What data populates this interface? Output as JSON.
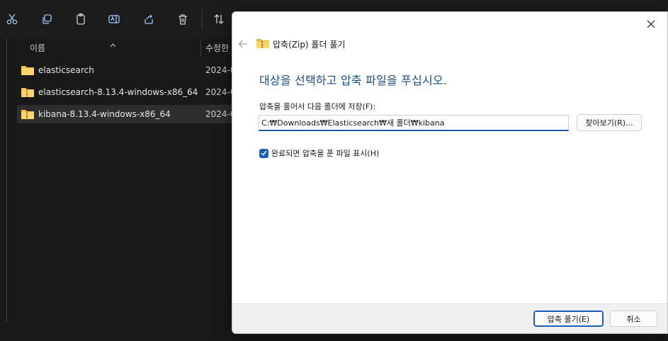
{
  "explorer": {
    "toolbar": {
      "icons": [
        "cut-icon",
        "copy-icon",
        "paste-icon",
        "rename-icon",
        "share-icon",
        "delete-icon",
        "sort-icon"
      ]
    },
    "columns": {
      "name": "이름",
      "modified": "수정한"
    },
    "files": [
      {
        "name": "elasticsearch",
        "date": "2024-0",
        "type": "folder"
      },
      {
        "name": "elasticsearch-8.13.4-windows-x86_64",
        "date": "2024-0",
        "type": "zip-folder"
      },
      {
        "name": "kibana-8.13.4-windows-x86_64",
        "date": "2024-0",
        "type": "zip-folder",
        "selected": true
      }
    ]
  },
  "dialog": {
    "title": "압축(Zip) 폴더 풀기",
    "heading": "대상을 선택하고 압축 파일을 푸십시오.",
    "destination_label": "압축을 풀어서 다음 폴더에 저장(F):",
    "destination_path": "C:₩Downloads₩Elasticsearch₩새 폴더₩kibana",
    "browse_label": "찾아보기(R)...",
    "show_files_label": "완료되면 압축을 푼 파일 표시(H)",
    "show_files_checked": true,
    "extract_label": "압축 풀기(E)",
    "cancel_label": "취소"
  },
  "colors": {
    "accent": "#1a5fb4",
    "heading": "#1a4e8a",
    "folder": "#f4c04c"
  }
}
